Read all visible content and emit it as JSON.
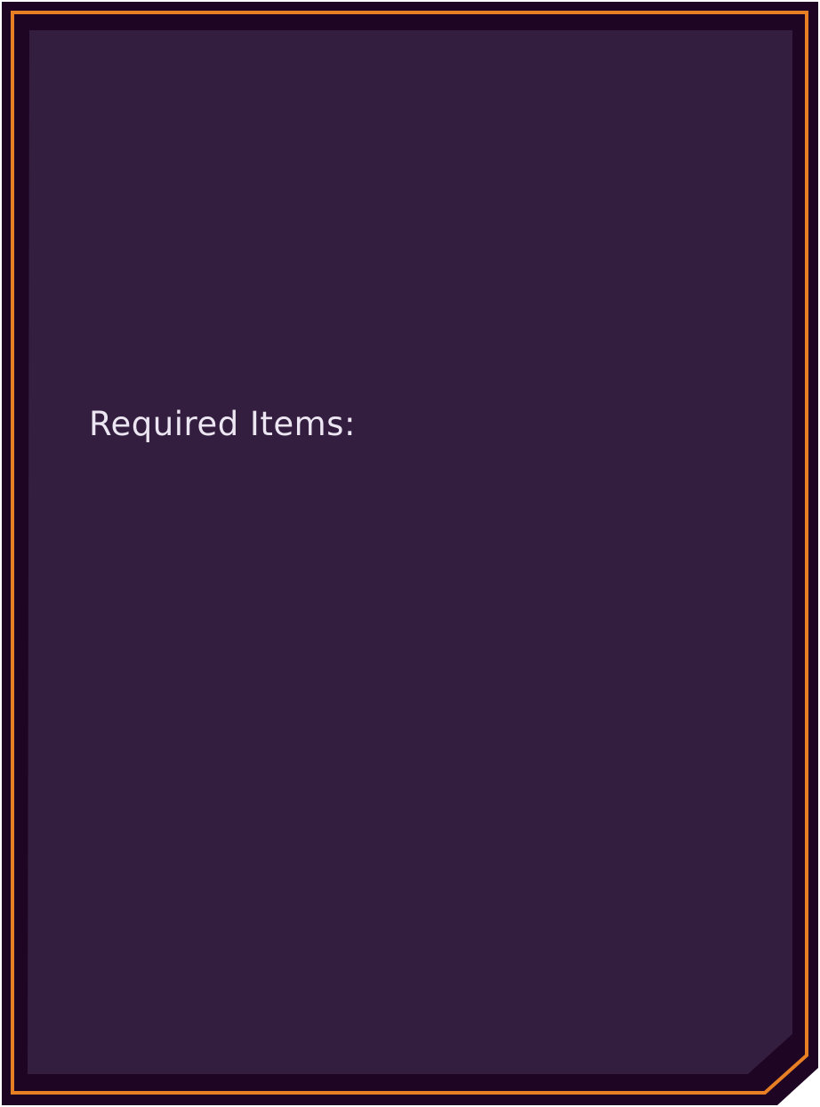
{
  "panel": {
    "required_items_label": "Required Items:"
  },
  "colors": {
    "frame_outer": "#1e0523",
    "frame_accent": "#e77f24",
    "panel_fill": "#341e40",
    "label_text": "#ece6f2"
  }
}
